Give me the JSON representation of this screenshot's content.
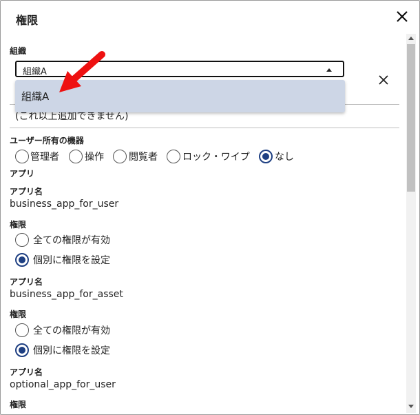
{
  "dialog": {
    "title": "権限"
  },
  "org": {
    "label": "組織",
    "selected": "組織A",
    "option": "組織A",
    "note": "(これ以上追加できません)"
  },
  "device": {
    "label": "ユーザー所有の機器",
    "options": [
      "管理者",
      "操作",
      "閲覧者",
      "ロック・ワイプ",
      "なし"
    ],
    "selected": "なし"
  },
  "apps": {
    "section_label": "アプリ",
    "name_label": "アプリ名",
    "perm_label": "権限",
    "opt_all": "全ての権限が有効",
    "opt_individual": "個別に権限を設定",
    "items": [
      {
        "name": "business_app_for_user",
        "selected": "個別に権限を設定"
      },
      {
        "name": "business_app_for_asset",
        "selected": "個別に権限を設定"
      },
      {
        "name": "optional_app_for_user"
      }
    ]
  },
  "icons": {
    "close": "close-icon",
    "remove": "close-icon",
    "pointer": "red-arrow-icon"
  },
  "colors": {
    "accent": "#1e3f82",
    "dropdown_bg": "#cdd6e6",
    "arrow": "#ee1111"
  }
}
